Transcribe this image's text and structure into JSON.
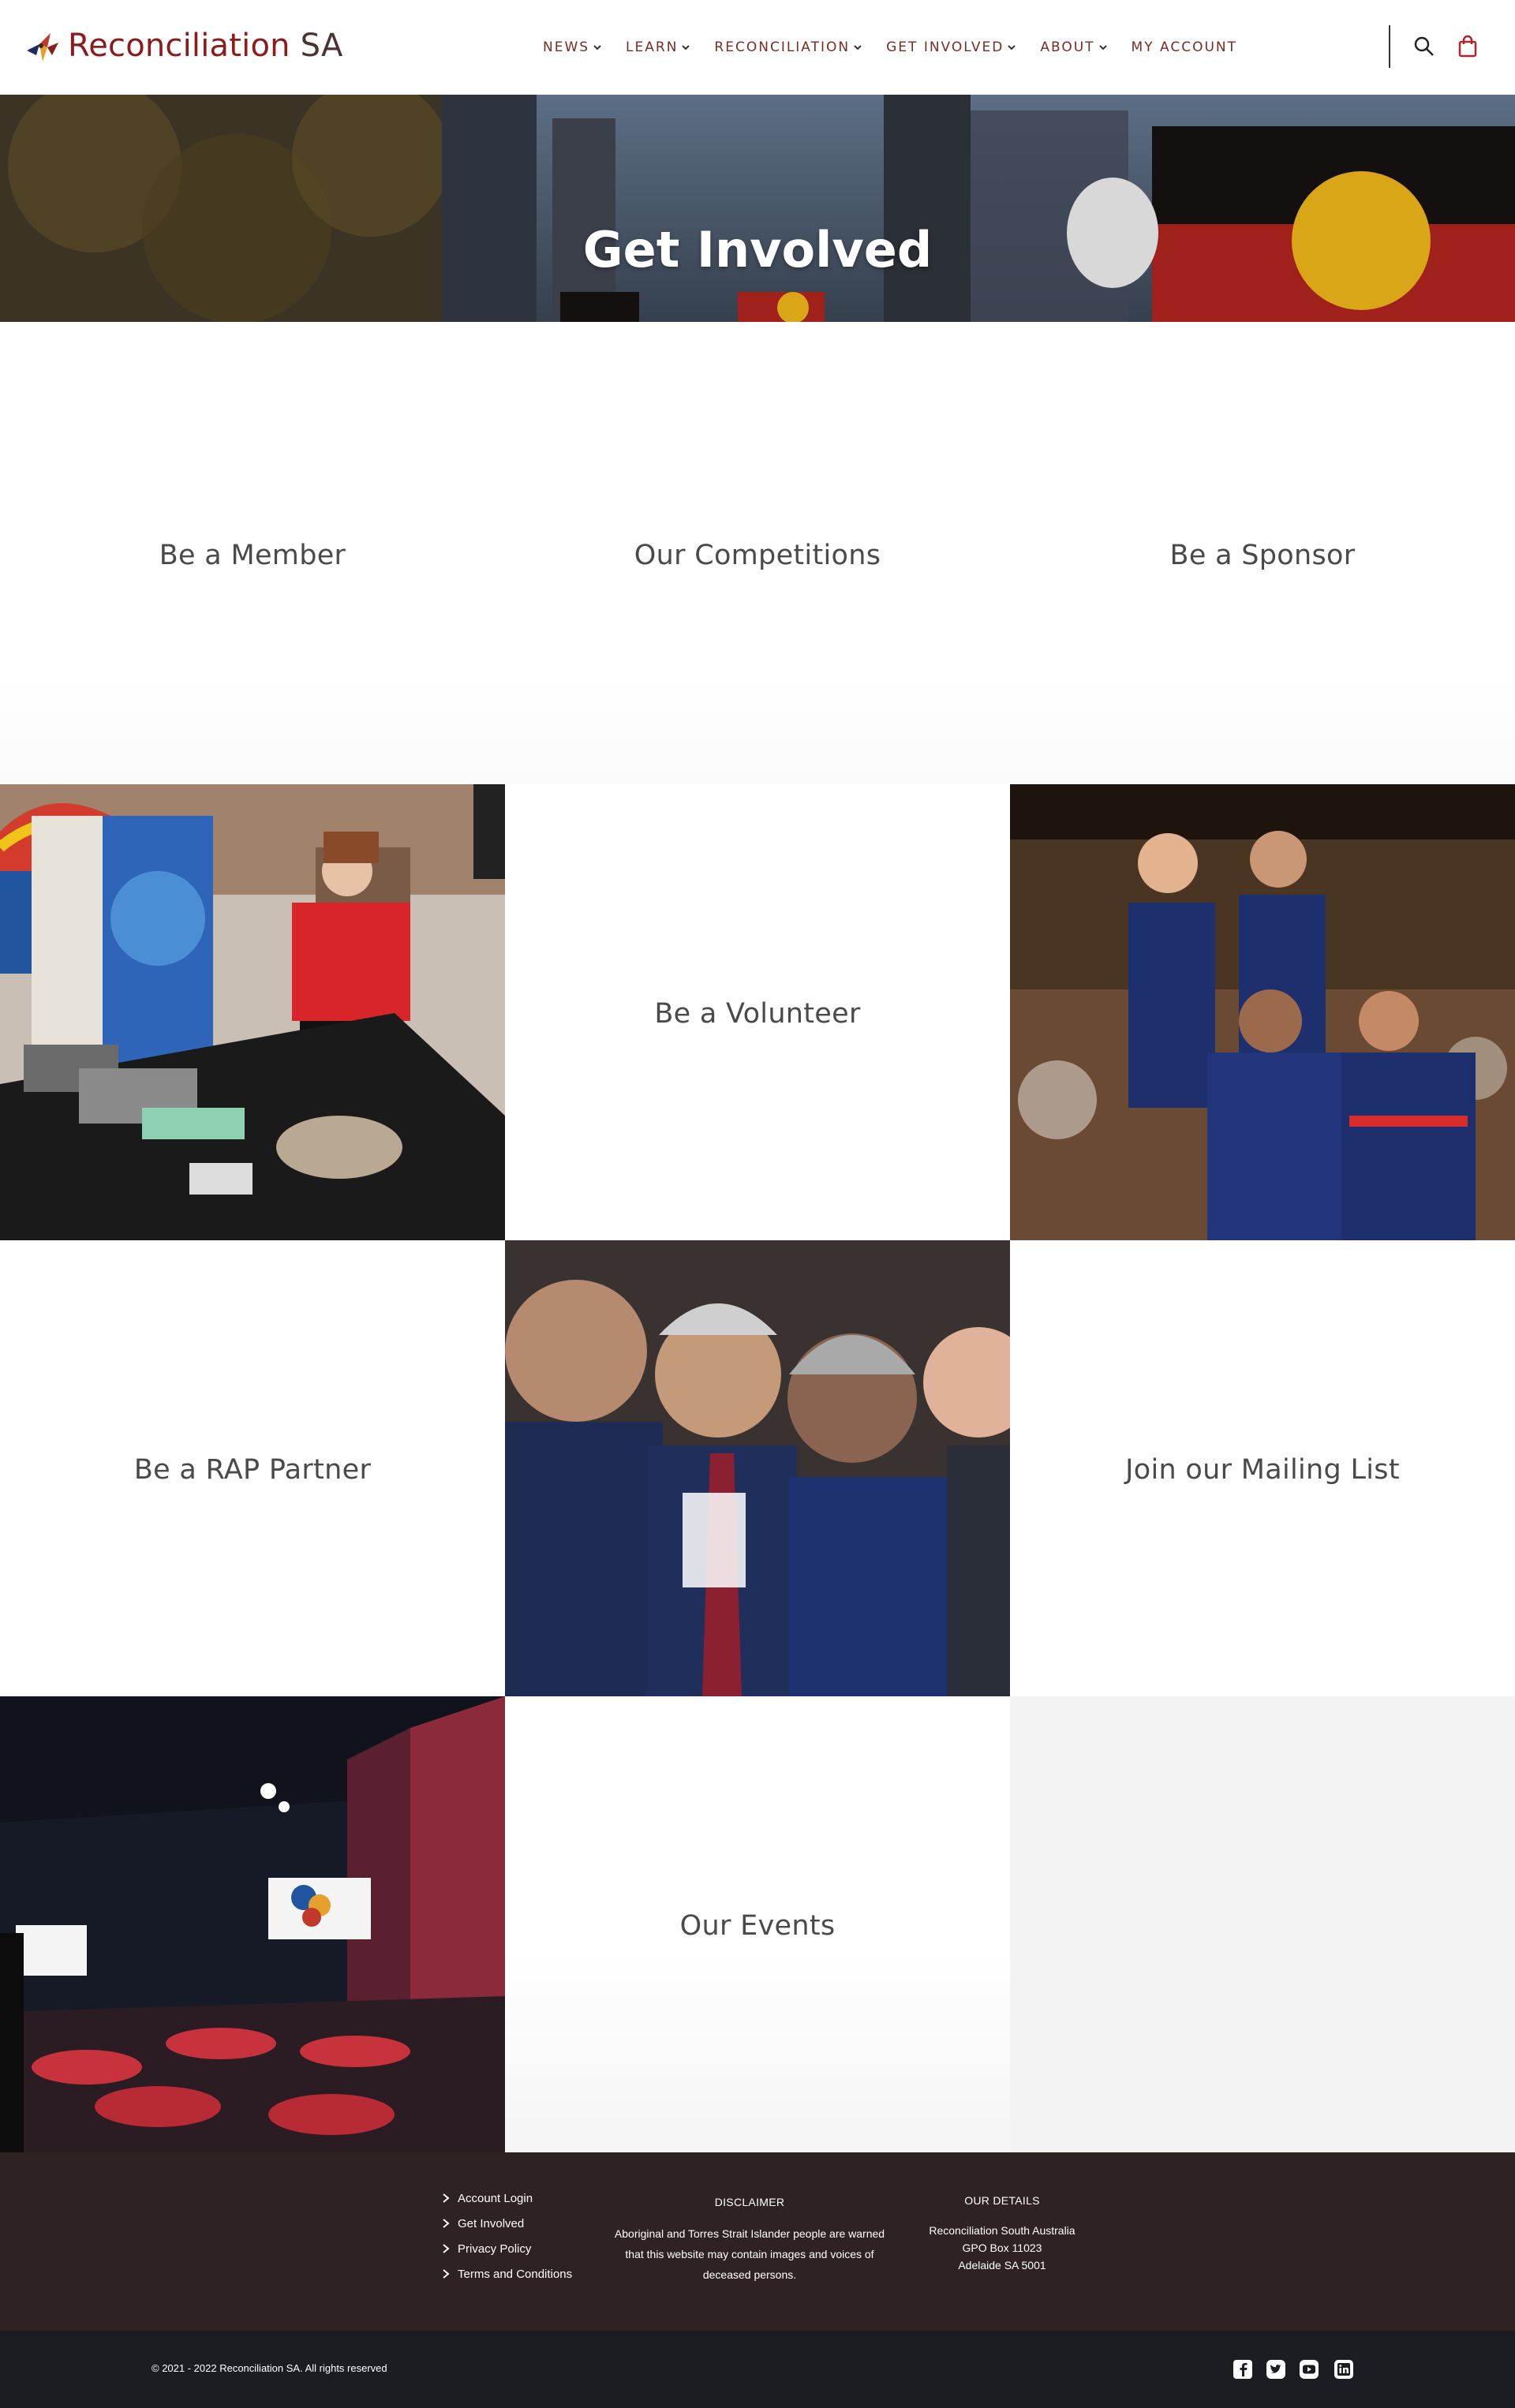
{
  "brand": {
    "name": "Reconciliation",
    "suffix": "SA"
  },
  "nav": {
    "items": [
      {
        "label": "NEWS",
        "dropdown": true
      },
      {
        "label": "LEARN",
        "dropdown": true
      },
      {
        "label": "RECONCILIATION",
        "dropdown": true
      },
      {
        "label": "GET INVOLVED",
        "dropdown": true
      },
      {
        "label": "ABOUT",
        "dropdown": true
      },
      {
        "label": "MY ACCOUNT",
        "dropdown": false
      }
    ],
    "icons": [
      "search-icon",
      "shopping-bag-icon"
    ]
  },
  "hero": {
    "title": "Get Involved"
  },
  "tiles": {
    "member": "Be a Member",
    "competitions": "Our Competitions",
    "sponsor": "Be a Sponsor",
    "volunteer": "Be a Volunteer",
    "rap_partner": "Be a RAP Partner",
    "mailing_list": "Join our Mailing List",
    "events": "Our Events"
  },
  "footer": {
    "links": [
      "Account Login",
      "Get Involved",
      "Privacy Policy",
      "Terms and Conditions"
    ],
    "disclaimer": {
      "heading": "DISCLAIMER",
      "line1": "Aboriginal and Torres Strait Islander people are warned",
      "line2": "that this website may contain images and voices of",
      "line3": "deceased persons."
    },
    "details": {
      "heading": "OUR DETAILS",
      "line1": "Reconciliation South Australia",
      "line2": "GPO Box 11023",
      "line3": "Adelaide SA 5001"
    },
    "copyright": "© 2021 - 2022 Reconciliation SA. All rights reserved",
    "social_icons": [
      "facebook-icon",
      "twitter-icon",
      "youtube-icon",
      "linkedin-icon"
    ]
  },
  "colors": {
    "brand_red": "#8e1b1b",
    "nav_text": "#7a2b26",
    "footer_bg": "#2e2322",
    "bottom_bar_bg": "#1b1d22"
  }
}
